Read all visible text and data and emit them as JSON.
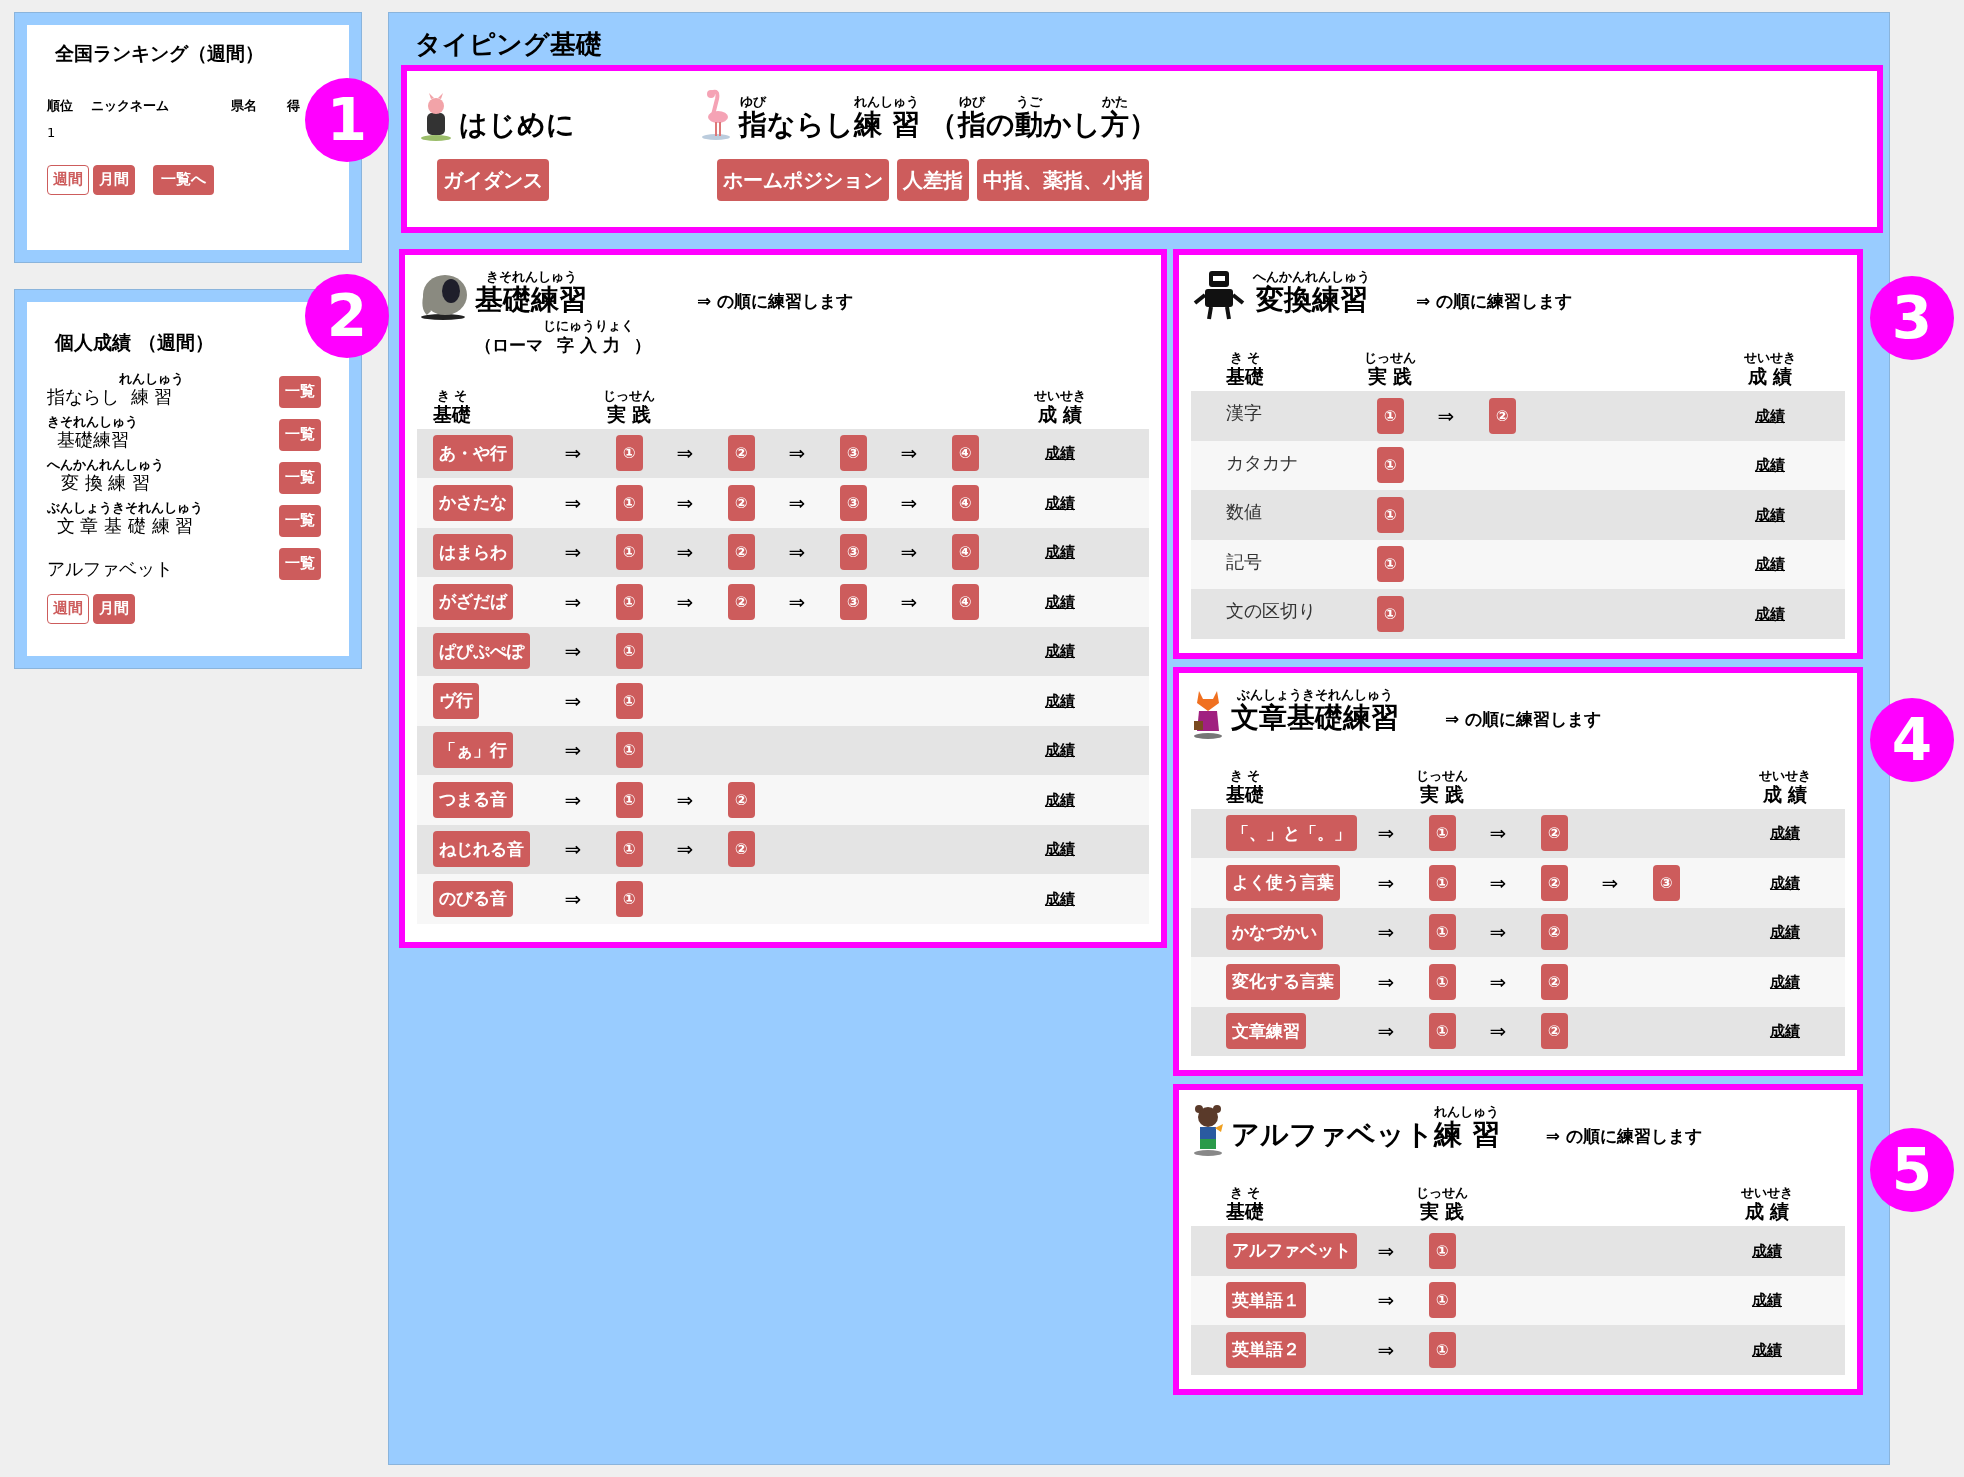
{
  "ranking": {
    "title": "全国ランキング（週間）",
    "columns": [
      "順位",
      "ニックネーム",
      "県名",
      "得"
    ],
    "rows": [
      [
        "1"
      ]
    ],
    "periods": [
      {
        "label": "週間",
        "selected": true
      },
      {
        "label": "月間",
        "selected": false
      }
    ],
    "list_button": "一覧へ"
  },
  "personal": {
    "title": "個人成績 （週間）",
    "items": [
      {
        "label": [
          {
            "text": "指ならし"
          },
          {
            "text": "練 習",
            "ruby": "れんしゅう"
          }
        ],
        "button": "一覧"
      },
      {
        "label": [
          {
            "text": "基礎練習",
            "ruby": "きそれんしゅう"
          }
        ],
        "button": "一覧"
      },
      {
        "label": [
          {
            "text": "変 換 練 習",
            "ruby": "へんかんれんしゅう"
          }
        ],
        "button": "一覧"
      },
      {
        "label": [
          {
            "text": "文 章 基 礎 練 習",
            "ruby": "ぶんしょうきそれんしゅう"
          }
        ],
        "button": "一覧"
      },
      {
        "label": [
          {
            "text": "アルファベット"
          }
        ],
        "button": "一覧"
      }
    ],
    "periods": [
      {
        "label": "週間",
        "selected": true
      },
      {
        "label": "月間",
        "selected": false
      }
    ]
  },
  "main": {
    "title": "タイピング基礎"
  },
  "markers": [
    "1",
    "2",
    "3",
    "4",
    "5"
  ],
  "intro": [
    {
      "title": [
        {
          "text": "はじめに"
        }
      ],
      "buttons": [
        "ガイダンス"
      ]
    },
    {
      "title": [
        {
          "text": "指",
          "ruby": "ゆび"
        },
        {
          "text": "ならし"
        },
        {
          "text": "練 習",
          "ruby": "れんしゅう"
        },
        {
          "text": " （"
        },
        {
          "text": "指",
          "ruby": "ゆび"
        },
        {
          "text": "の"
        },
        {
          "text": "動",
          "ruby": "うご"
        },
        {
          "text": "かし"
        },
        {
          "text": "方",
          "ruby": "かた"
        },
        {
          "text": "）"
        }
      ],
      "buttons": [
        "ホームポジション",
        "人差指",
        "中指、薬指、小指"
      ]
    }
  ],
  "sections": [
    {
      "title": [
        {
          "text": "基礎練習",
          "ruby": "きそれんしゅう"
        }
      ],
      "subtitle": [
        {
          "text": "（ローマ"
        },
        {
          "text": "字 入 力",
          "ruby": "じにゅうりょく"
        },
        {
          "text": "）"
        }
      ],
      "note": "⇒ の順に練習します",
      "headers": [
        [
          {
            "text": "基礎",
            "ruby": "き そ"
          }
        ],
        [
          {
            "text": "実 践",
            "ruby": "じっせん"
          }
        ],
        [
          {
            "text": "成 績",
            "ruby": "せいせき"
          }
        ]
      ],
      "rows": [
        {
          "label": "あ・や行",
          "kind": "button",
          "steps": [
            [
              "⇒",
              "①"
            ],
            [
              "⇒",
              "②"
            ],
            [
              "⇒",
              "③"
            ],
            [
              "⇒",
              "④"
            ]
          ],
          "result": "成績"
        },
        {
          "label": "かさたな",
          "kind": "button",
          "steps": [
            [
              "⇒",
              "①"
            ],
            [
              "⇒",
              "②"
            ],
            [
              "⇒",
              "③"
            ],
            [
              "⇒",
              "④"
            ]
          ],
          "result": "成績"
        },
        {
          "label": "はまらわ",
          "kind": "button",
          "steps": [
            [
              "⇒",
              "①"
            ],
            [
              "⇒",
              "②"
            ],
            [
              "⇒",
              "③"
            ],
            [
              "⇒",
              "④"
            ]
          ],
          "result": "成績"
        },
        {
          "label": "がざだば",
          "kind": "button",
          "steps": [
            [
              "⇒",
              "①"
            ],
            [
              "⇒",
              "②"
            ],
            [
              "⇒",
              "③"
            ],
            [
              "⇒",
              "④"
            ]
          ],
          "result": "成績"
        },
        {
          "label": "ぱぴぷぺぽ",
          "kind": "button",
          "steps": [
            [
              "⇒",
              "①"
            ]
          ],
          "result": "成績"
        },
        {
          "label": "ヴ行",
          "kind": "button",
          "steps": [
            [
              "⇒",
              "①"
            ]
          ],
          "result": "成績"
        },
        {
          "label": "「ぁ」行",
          "kind": "button",
          "steps": [
            [
              "⇒",
              "①"
            ]
          ],
          "result": "成績"
        },
        {
          "label": "つまる音",
          "kind": "button",
          "steps": [
            [
              "⇒",
              "①"
            ],
            [
              "⇒",
              "②"
            ]
          ],
          "result": "成績"
        },
        {
          "label": "ねじれる音",
          "kind": "button",
          "steps": [
            [
              "⇒",
              "①"
            ],
            [
              "⇒",
              "②"
            ]
          ],
          "result": "成績"
        },
        {
          "label": "のびる音",
          "kind": "button",
          "steps": [
            [
              "⇒",
              "①"
            ]
          ],
          "result": "成績"
        }
      ]
    },
    {
      "title": [
        {
          "text": "変換練習",
          "ruby": "へんかんれんしゅう"
        }
      ],
      "note": "⇒ の順に練習します",
      "headers": [
        [
          {
            "text": "基礎",
            "ruby": "き そ"
          }
        ],
        [
          {
            "text": "実 践",
            "ruby": "じっせん"
          }
        ],
        [
          {
            "text": "成 績",
            "ruby": "せいせき"
          }
        ]
      ],
      "rows": [
        {
          "label": "漢字",
          "kind": "plain",
          "steps": [
            [
              "①"
            ],
            [
              "⇒",
              "②"
            ]
          ],
          "result": "成績"
        },
        {
          "label": "カタカナ",
          "kind": "plain",
          "steps": [
            [
              "①"
            ]
          ],
          "result": "成績"
        },
        {
          "label": "数値",
          "kind": "plain",
          "steps": [
            [
              "①"
            ]
          ],
          "result": "成績"
        },
        {
          "label": "記号",
          "kind": "plain",
          "steps": [
            [
              "①"
            ]
          ],
          "result": "成績"
        },
        {
          "label": "文の区切り",
          "kind": "plain",
          "steps": [
            [
              "①"
            ]
          ],
          "result": "成績"
        }
      ]
    },
    {
      "title": [
        {
          "text": "文章基礎練習",
          "ruby": "ぶんしょうきそれんしゅう"
        }
      ],
      "note": "⇒ の順に練習します",
      "headers": [
        [
          {
            "text": "基礎",
            "ruby": "き そ"
          }
        ],
        [
          {
            "text": "実 践",
            "ruby": "じっせん"
          }
        ],
        [
          {
            "text": "成 績",
            "ruby": "せいせき"
          }
        ]
      ],
      "rows": [
        {
          "label": "「、」と「。」",
          "kind": "button",
          "steps": [
            [
              "⇒",
              "①"
            ],
            [
              "⇒",
              "②"
            ]
          ],
          "result": "成績"
        },
        {
          "label": "よく使う言葉",
          "kind": "button",
          "steps": [
            [
              "⇒",
              "①"
            ],
            [
              "⇒",
              "②"
            ],
            [
              "⇒",
              "③"
            ]
          ],
          "result": "成績"
        },
        {
          "label": "かなづかい",
          "kind": "button",
          "steps": [
            [
              "⇒",
              "①"
            ],
            [
              "⇒",
              "②"
            ]
          ],
          "result": "成績"
        },
        {
          "label": "変化する言葉",
          "kind": "button",
          "steps": [
            [
              "⇒",
              "①"
            ],
            [
              "⇒",
              "②"
            ]
          ],
          "result": "成績"
        },
        {
          "label": "文章練習",
          "kind": "button",
          "steps": [
            [
              "⇒",
              "①"
            ],
            [
              "⇒",
              "②"
            ]
          ],
          "result": "成績"
        }
      ]
    },
    {
      "title": [
        {
          "text": "アルファベット"
        },
        {
          "text": "練 習",
          "ruby": "れんしゅう"
        }
      ],
      "note": "⇒ の順に練習します",
      "headers": [
        [
          {
            "text": "基礎",
            "ruby": "き そ"
          }
        ],
        [
          {
            "text": "実 践",
            "ruby": "じっせん"
          }
        ],
        [
          {
            "text": "成 績",
            "ruby": "せいせき"
          }
        ]
      ],
      "rows": [
        {
          "label": "アルファベット",
          "kind": "button",
          "steps": [
            [
              "⇒",
              "①"
            ]
          ],
          "result": "成績"
        },
        {
          "label": "英単語１",
          "kind": "button",
          "steps": [
            [
              "⇒",
              "①"
            ]
          ],
          "result": "成績"
        },
        {
          "label": "英単語２",
          "kind": "button",
          "steps": [
            [
              "⇒",
              "①"
            ]
          ],
          "result": "成績"
        }
      ]
    }
  ]
}
